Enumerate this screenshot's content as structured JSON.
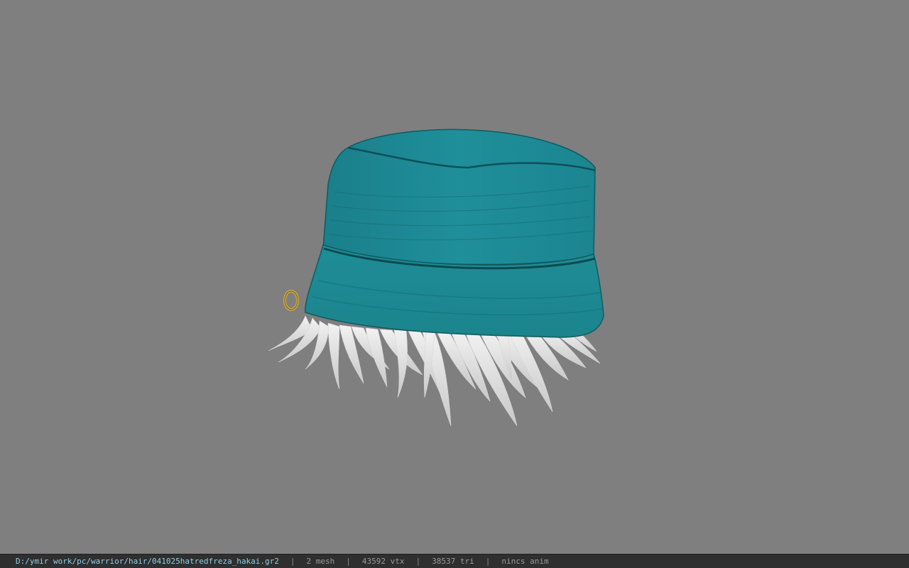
{
  "viewer": {
    "background_color": "#7f7f7f",
    "model": {
      "description_icon": "bucket-hat-with-hair-model",
      "hat_color": "#1f8e98",
      "hair_color": "#e2e2e2",
      "ring_color": "#c9a640"
    }
  },
  "status_bar": {
    "file_path": "D:/ymir work/pc/warrior/hair/041025hatredfreza_hakai.gr2",
    "separator": "|",
    "mesh_count": "2 mesh",
    "vertex_count": "43592 vtx",
    "triangle_count": "38537 tri",
    "animation": "nincs anim"
  }
}
